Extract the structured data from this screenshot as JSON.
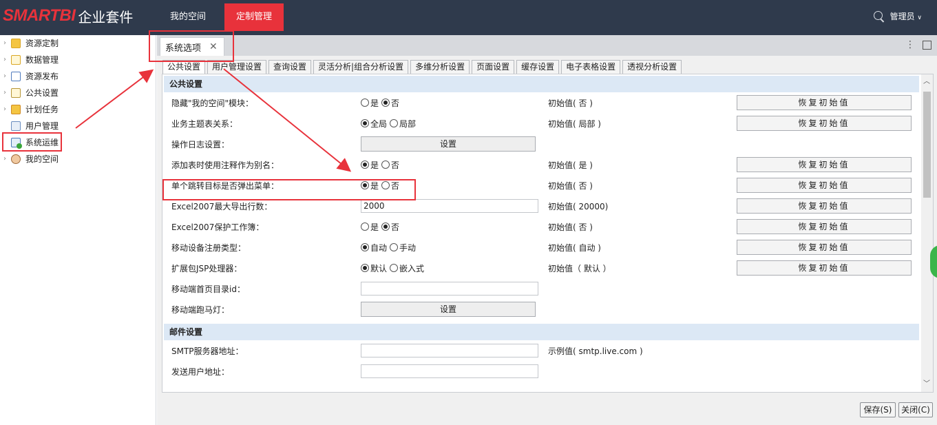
{
  "header": {
    "logo_brand": "SMARTBI",
    "logo_suite": "企业套件",
    "nav_tabs": [
      "我的空间",
      "定制管理"
    ],
    "active_tab": "定制管理",
    "user_label": "管理员",
    "user_caret": "∨"
  },
  "sidebar": {
    "items": [
      {
        "label": "资源定制",
        "icon": "folder-icon",
        "expandable": true
      },
      {
        "label": "数据管理",
        "icon": "document-icon",
        "expandable": true
      },
      {
        "label": "资源发布",
        "icon": "publish-icon",
        "expandable": true
      },
      {
        "label": "公共设置",
        "icon": "settings-icon",
        "expandable": true
      },
      {
        "label": "计划任务",
        "icon": "rss-folder-icon",
        "expandable": true
      },
      {
        "label": "用户管理",
        "icon": "user-manage-icon",
        "expandable": false
      },
      {
        "label": "系统运维",
        "icon": "system-ops-icon",
        "expandable": false
      },
      {
        "label": "我的空间",
        "icon": "person-icon",
        "expandable": true
      }
    ]
  },
  "doc_tab": {
    "title": "系统选项",
    "close": "✕",
    "menu": "⋮"
  },
  "subtabs": [
    "公共设置",
    "用户管理设置",
    "查询设置",
    "灵活分析|组合分析设置",
    "多维分析设置",
    "页面设置",
    "缓存设置",
    "电子表格设置",
    "透视分析设置"
  ],
  "active_subtab": "公共设置",
  "restore_label": "恢复初始值",
  "set_label": "设置",
  "sections": [
    {
      "title": "公共设置",
      "rows": [
        {
          "label": "隐藏\"我的空间\"模块：",
          "type": "radio",
          "options": [
            "是",
            "否"
          ],
          "selected": 1,
          "initial": "初始值( 否 )",
          "restore": true
        },
        {
          "label": "业务主题表关系：",
          "type": "radio",
          "options": [
            "全局",
            "局部"
          ],
          "selected": 0,
          "initial": "初始值( 局部 )",
          "restore": true
        },
        {
          "label": "操作日志设置：",
          "type": "button",
          "initial": "",
          "restore": false
        },
        {
          "label": "添加表时使用注释作为别名：",
          "type": "radio",
          "options": [
            "是",
            "否"
          ],
          "selected": 0,
          "initial": "初始值( 是 )",
          "restore": true
        },
        {
          "label": "单个跳转目标是否弹出菜单：",
          "type": "radio",
          "options": [
            "是",
            "否"
          ],
          "selected": 0,
          "initial": "初始值( 否 )",
          "restore": true
        },
        {
          "label": "Excel2007最大导出行数：",
          "type": "text",
          "value": "2000",
          "initial": "初始值( 20000)",
          "restore": true
        },
        {
          "label": "Excel2007保护工作簿：",
          "type": "radio",
          "options": [
            "是",
            "否"
          ],
          "selected": 1,
          "initial": "初始值( 否 )",
          "restore": true
        },
        {
          "label": "移动设备注册类型：",
          "type": "radio",
          "options": [
            "自动",
            "手动"
          ],
          "selected": 0,
          "initial": "初始值( 自动 )",
          "restore": true
        },
        {
          "label": "扩展包JSP处理器：",
          "type": "radio",
          "options": [
            "默认",
            "嵌入式"
          ],
          "selected": 0,
          "initial": "初始值（ 默认 ）",
          "restore": true
        },
        {
          "label": "移动端首页目录id：",
          "type": "text",
          "value": "",
          "initial": "",
          "restore": false
        },
        {
          "label": "移动端跑马灯：",
          "type": "button",
          "initial": "",
          "restore": false
        }
      ]
    },
    {
      "title": "邮件设置",
      "rows": [
        {
          "label": "SMTP服务器地址：",
          "type": "text",
          "value": "",
          "initial": "示例值( smtp.live.com )",
          "restore": false
        },
        {
          "label": "发送用户地址：",
          "type": "text",
          "value": "",
          "initial": "",
          "restore": false
        }
      ]
    }
  ],
  "footer": {
    "save": "保存(S)",
    "close": "关闭(C)"
  },
  "colors": {
    "topbar": "#2f3a4c",
    "accent": "#e8323b",
    "section_bg": "#dce8f5",
    "annotation": "#e8323b"
  }
}
